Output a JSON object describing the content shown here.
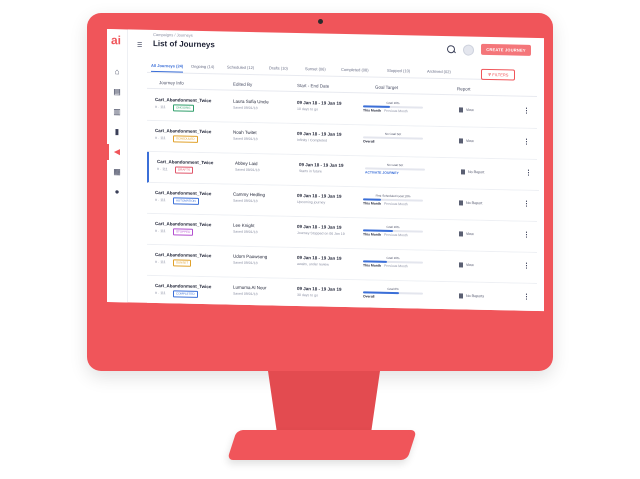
{
  "app": {
    "logo": "ai"
  },
  "header": {
    "breadcrumb": "Campaigns / Journeys",
    "title": "List of Journeys",
    "create_label": "CREATE JOURNEY"
  },
  "tabs": [
    {
      "label": "All Journeys (24)"
    },
    {
      "label": "Ongoing (14)"
    },
    {
      "label": "Scheduled (12)"
    },
    {
      "label": "Drafts (10)"
    },
    {
      "label": "Sunset (06)"
    },
    {
      "label": "Completed (08)"
    },
    {
      "label": "Stopped (10)"
    },
    {
      "label": "Archived (02)"
    }
  ],
  "filters_label": "FILTERS",
  "columns": [
    "Journey Info",
    "Edited By",
    "Start - End Date",
    "Goal Target",
    "Report"
  ],
  "rows": [
    {
      "name": "Cart_Abandonment_Twice",
      "meta": "# · 111",
      "badge": "ONGOING",
      "badge_color": "#2e9e6a",
      "editor": "Laura Sofia Uncle",
      "editor_sub": "Saved 09/01/18",
      "dates": "09 Jan 18 - 19 Jan 19",
      "date_sub": "10 days to go",
      "goal_top": "Goal 10%",
      "goal_fill": 0.45,
      "goal_label": "This Month",
      "goal_sub": "Previous Month",
      "report": "View"
    },
    {
      "name": "Cart_Abandonment_Twice",
      "meta": "# · 111",
      "badge": "SCHEDULED",
      "badge_color": "#e0a12b",
      "editor": "Noah Twitet",
      "editor_sub": "Saved 09/01/18",
      "dates": "09 Jan 18 - 19 Jan 19",
      "date_sub": "Infinity / Completed",
      "goal_top": "No Goal Set",
      "goal_fill": 0.0,
      "goal_label": "Overall",
      "goal_sub": "",
      "report": "View"
    },
    {
      "name": "Cart_Abandonment_Twice",
      "meta": "# · 111",
      "badge": "DRAFTS",
      "badge_color": "#e0556a",
      "editor": "Abbey Laid",
      "editor_sub": "Saved 09/01/18",
      "dates": "09 Jan 18 - 19 Jan 19",
      "date_sub": "Starts in future",
      "goal_top": "No Goal Set",
      "goal_fill": 0.0,
      "goal_label": "ACTIVATE JOURNEY",
      "goal_sub": "",
      "report": "No Report"
    },
    {
      "name": "Cart_Abandonment_Twice",
      "meta": "# · 111",
      "badge": "AUTOMATION",
      "badge_color": "#3b6fd8",
      "editor": "Cammy Hedling",
      "editor_sub": "Saved 09/01/18",
      "dates": "09 Jan 18 - 19 Jan 19",
      "date_sub": "Upcoming journey",
      "goal_top": "First Scheduled Goal 10%",
      "goal_fill": 0.3,
      "goal_label": "This Month",
      "goal_sub": "Previous Month",
      "report": "No Report"
    },
    {
      "name": "Cart_Abandonment_Twice",
      "meta": "# · 111",
      "badge": "STOPPED",
      "badge_color": "#b34fd0",
      "editor": "Lee Knight",
      "editor_sub": "Saved 09/01/18",
      "dates": "09 Jan 18 - 19 Jan 19",
      "date_sub": "Journey Stopped on 06 Jan 19",
      "goal_top": "Goal 10%",
      "goal_fill": 0.5,
      "goal_label": "This Month",
      "goal_sub": "Previous Month",
      "report": "View"
    },
    {
      "name": "Cart_Abandonment_Twice",
      "meta": "# · 111",
      "badge": "SUNSET",
      "badge_color": "#e0a12b",
      "editor": "Udom Paowsong",
      "editor_sub": "Saved 09/01/18",
      "dates": "09 Jan 18 - 19 Jan 19",
      "date_sub": "awaits, under review",
      "goal_top": "Goal 10%",
      "goal_fill": 0.4,
      "goal_label": "This Month",
      "goal_sub": "Previous Month",
      "report": "View"
    },
    {
      "name": "Cart_Abandonment_Twice",
      "meta": "# · 111",
      "badge": "COMPLETED",
      "badge_color": "#3b6fd8",
      "editor": "Lumuma Al Nour",
      "editor_sub": "Saved 09/01/18",
      "dates": "09 Jan 18 - 19 Jan 19",
      "date_sub": "30 days to go",
      "goal_top": "Goal 8%",
      "goal_fill": 0.6,
      "goal_label": "Overall",
      "goal_sub": "",
      "report": "No Reports"
    }
  ]
}
